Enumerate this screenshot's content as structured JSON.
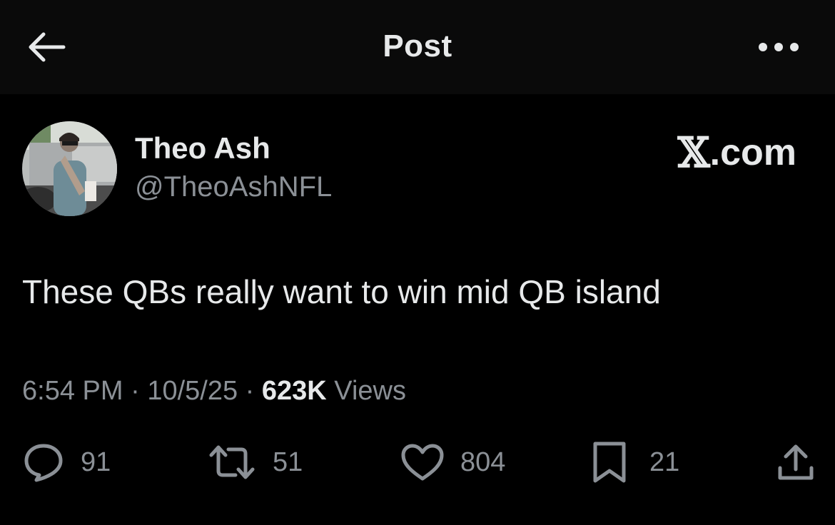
{
  "header": {
    "title": "Post",
    "back_icon": "arrow-left-icon",
    "more_icon": "more-horizontal-icon"
  },
  "author": {
    "display_name": "Theo Ash",
    "handle": "@TheoAshNFL",
    "avatar_icon": "avatar-photo"
  },
  "brand": {
    "x": "𝕏",
    "text": ".com"
  },
  "post": {
    "text": "These QBs really want to win mid QB island"
  },
  "meta": {
    "time": "6:54 PM",
    "date": "10/5/25",
    "separator": "·",
    "views_count": "623K",
    "views_label": "Views"
  },
  "actions": {
    "replies": {
      "icon": "reply-icon",
      "count": "91"
    },
    "reposts": {
      "icon": "repost-icon",
      "count": "51"
    },
    "likes": {
      "icon": "heart-icon",
      "count": "804"
    },
    "bookmarks": {
      "icon": "bookmark-icon",
      "count": "21"
    },
    "share": {
      "icon": "share-icon"
    }
  },
  "colors": {
    "background": "#000000",
    "header_background": "#0a0a0a",
    "primary_text": "#e7e9ea",
    "secondary_text": "#8b9096"
  }
}
